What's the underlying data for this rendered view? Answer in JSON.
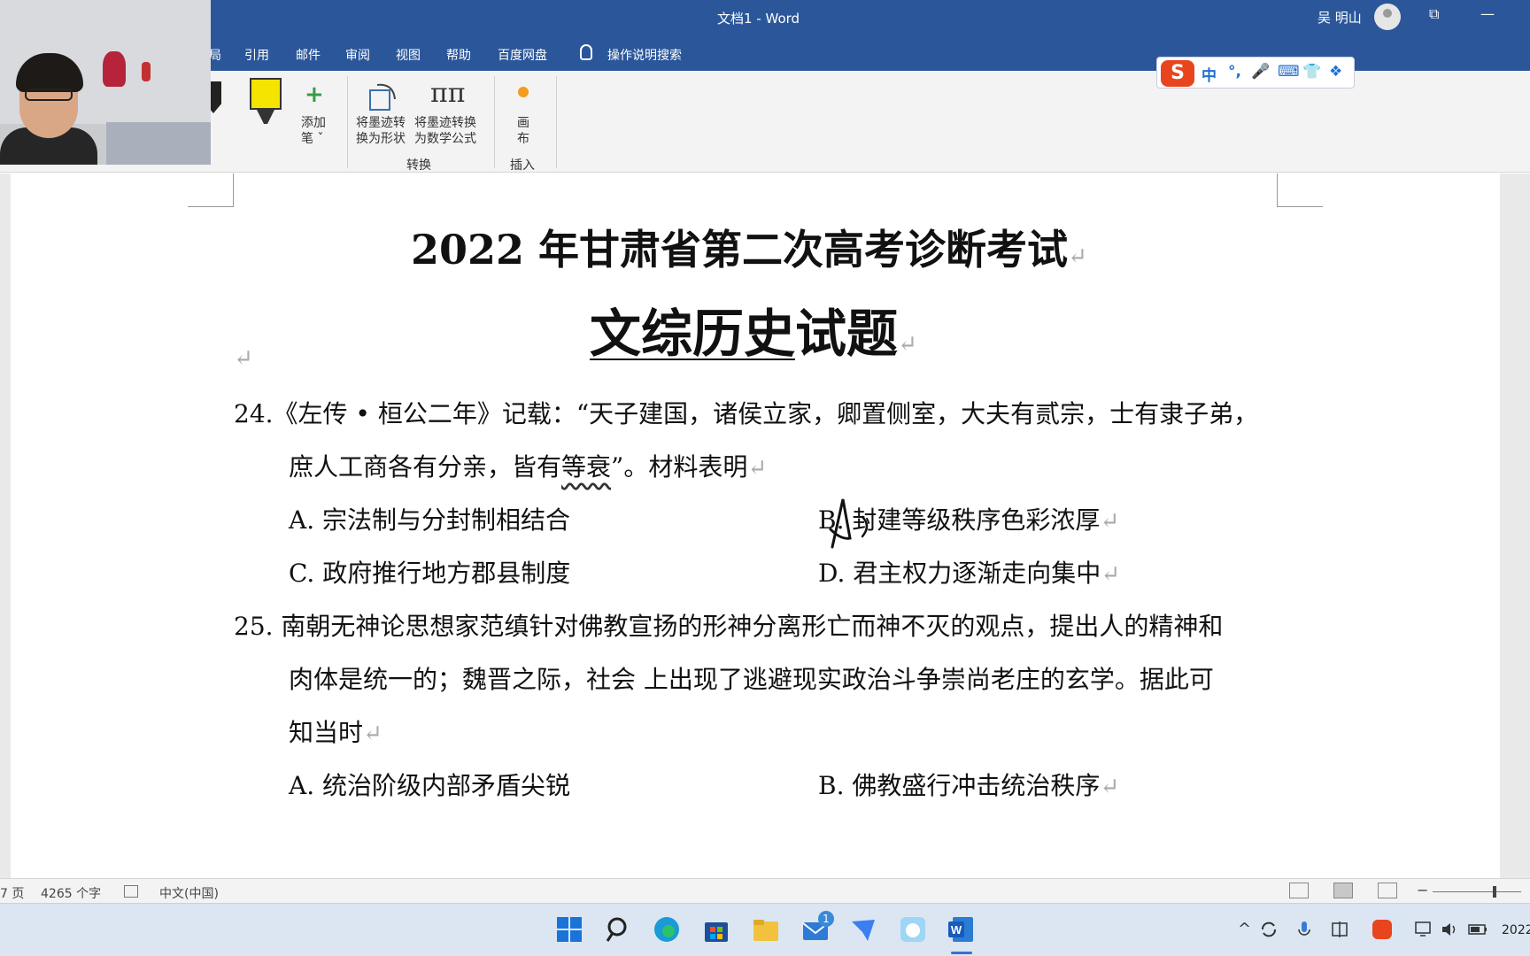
{
  "window": {
    "title": "文档1  -  Word",
    "user_name": "吴 明山",
    "restore_glyph": "⧉",
    "minimize_glyph": "—"
  },
  "menu": {
    "items": [
      "局",
      "引用",
      "邮件",
      "审阅",
      "视图",
      "帮助",
      "百度网盘"
    ],
    "search_label": "操作说明搜索"
  },
  "ribbon": {
    "add_pen_label": "添加",
    "add_pen_sub": "笔 ˇ",
    "to_shape_l1": "将墨迹转",
    "to_shape_l2": "换为形状",
    "to_math_l1": "将墨迹转换",
    "to_math_l2": "为数学公式",
    "canvas_l1": "画",
    "canvas_l2": "布",
    "group_convert": "转换",
    "group_insert": "插入",
    "pi_glyph": "ππ",
    "plus_glyph": "+"
  },
  "ime": {
    "logo": "S",
    "items": [
      "中",
      "°,",
      "🎤",
      "⌨",
      "👕",
      "❖"
    ]
  },
  "document": {
    "title1": "2022 年甘肃省第二次高考诊断考试",
    "title2_underlined": "文综历史",
    "title2_rest": "试题",
    "para_mark": "↵",
    "q24_line1": "24.《左传 • 桓公二年》记载：“天子建国，诸侯立家，卿置侧室，大夫有贰宗，士有隶子弟，",
    "q24_line2_a": "庶人工商各有分亲，皆有",
    "q24_line2_wavy": "等衰",
    "q24_line2_b": "”。材料表明",
    "q24_options": {
      "A": "A.  宗法制与分封制相结合",
      "B": "B.  封建等级秩序色彩浓厚",
      "C": "C.  政府推行地方郡县制度",
      "D": "D.  君主权力逐渐走向集中"
    },
    "q25_line1": "25.  南朝无神论思想家范缜针对佛教宣扬的形神分离形亡而神不灭的观点，提出人的精神和",
    "q25_line2": "肉体是统一的；魏晋之际，社会  上出现了逃避现实政治斗争崇尚老庄的玄学。据此可",
    "q25_line3": "知当时",
    "q25_options": {
      "A": "A.  统治阶级内部矛盾尖锐",
      "B": "B.  佛教盛行冲击统治秩序"
    }
  },
  "statusbar": {
    "page": "7 页",
    "word_count": "4265 个字",
    "language": "中文(中国)",
    "zoom_minus": "−"
  },
  "taskbar": {
    "mail_badge": "1",
    "clock": "2022"
  },
  "colors": {
    "word_blue": "#2b579a",
    "ribbon_bg": "#f3f3f3",
    "ime_red": "#e8451f"
  }
}
